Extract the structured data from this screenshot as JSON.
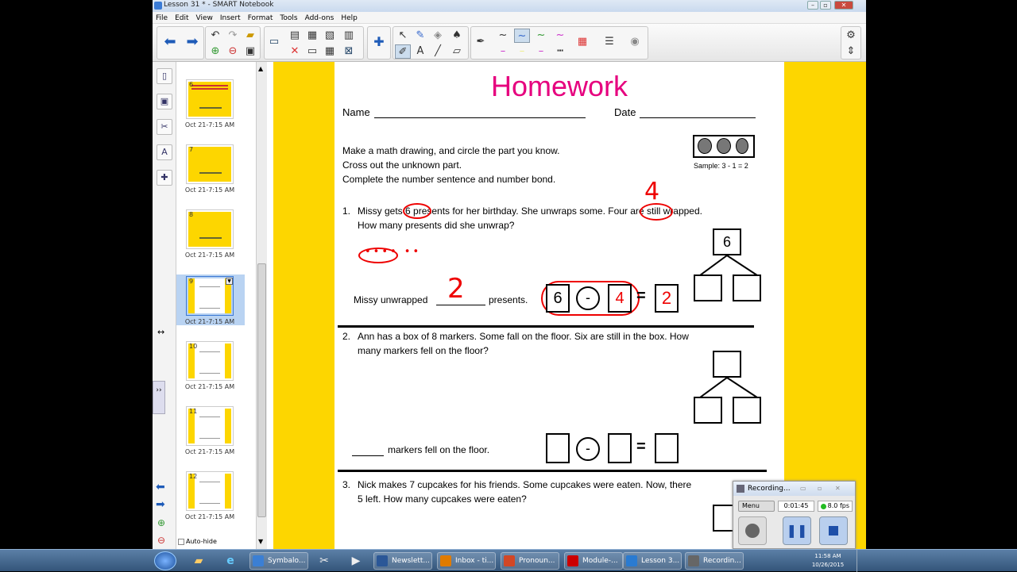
{
  "window": {
    "title": "Lesson 31 * - SMART Notebook"
  },
  "menu": [
    "File",
    "Edit",
    "View",
    "Insert",
    "Format",
    "Tools",
    "Add-ons",
    "Help"
  ],
  "sorter": {
    "pages": [
      {
        "number": "6",
        "time": "Oct 21-7:15 AM",
        "style": "yellow"
      },
      {
        "number": "7",
        "time": "Oct 21-7:15 AM",
        "style": "yellow"
      },
      {
        "number": "8",
        "time": "Oct 21-7:15 AM",
        "style": "yellow"
      },
      {
        "number": "9",
        "time": "Oct 21-7:15 AM",
        "style": "sheet",
        "selected": true
      },
      {
        "number": "10",
        "time": "Oct 21-7:15 AM",
        "style": "sheet"
      },
      {
        "number": "11",
        "time": "Oct 21-7:15 AM",
        "style": "sheet"
      },
      {
        "number": "12",
        "time": "Oct 21-7:15 AM",
        "style": "sheet"
      }
    ],
    "autohide_label": "Auto-hide"
  },
  "homework": {
    "title": "Homework",
    "name_label": "Name",
    "date_label": "Date",
    "instructions": [
      "Make a math drawing, and circle the part you know.",
      "Cross out the unknown part.",
      "Complete the number sentence and number bond."
    ],
    "sample": "Sample: 3 - 1 = 2",
    "problems": [
      {
        "num": "1.",
        "line1": "Missy gets 6 presents for her birthday.  She unwraps some.  Four are still wrapped.",
        "line2": "How many presents did she unwrap?",
        "answer_prefix": "Missy unwrapped",
        "answer_suffix": "presents.",
        "bond_whole": "6",
        "eq_a": "6",
        "eq_op": "-",
        "eq_b": "4",
        "eq_eq": "=",
        "eq_result": "2",
        "hand_answer": "2",
        "hand_four": "4"
      },
      {
        "num": "2.",
        "line1": "Ann has a box of 8 markers.  Some fall on the floor.  Six are still in the box.  How",
        "line2": "many markers fell on the floor?",
        "answer_suffix": "markers fell on the floor.",
        "eq_op": "-",
        "eq_eq": "="
      },
      {
        "num": "3.",
        "line1": "Nick makes 7 cupcakes for his friends.  Some cupcakes were eaten.  Now, there",
        "line2": "5 left.  How many cupcakes were eaten?"
      }
    ]
  },
  "recorder": {
    "title": "Recording...",
    "menu": "Menu",
    "time": "0:01:45",
    "fps": "8.0 fps"
  },
  "taskbar": {
    "items": [
      {
        "label": "Symbalo...",
        "color": "#3b7fd4"
      },
      {
        "label": "Newslett...",
        "color": "#2b5797"
      },
      {
        "label": "Inbox - ti...",
        "color": "#e07b00"
      },
      {
        "label": "Pronoun...",
        "color": "#d24726"
      },
      {
        "label": "Module-...",
        "color": "#c00"
      },
      {
        "label": "Lesson 3...",
        "color": "#2a7bd1"
      },
      {
        "label": "Recordin...",
        "color": "#666"
      }
    ],
    "time": "11:58 AM",
    "date": "10/26/2015"
  }
}
